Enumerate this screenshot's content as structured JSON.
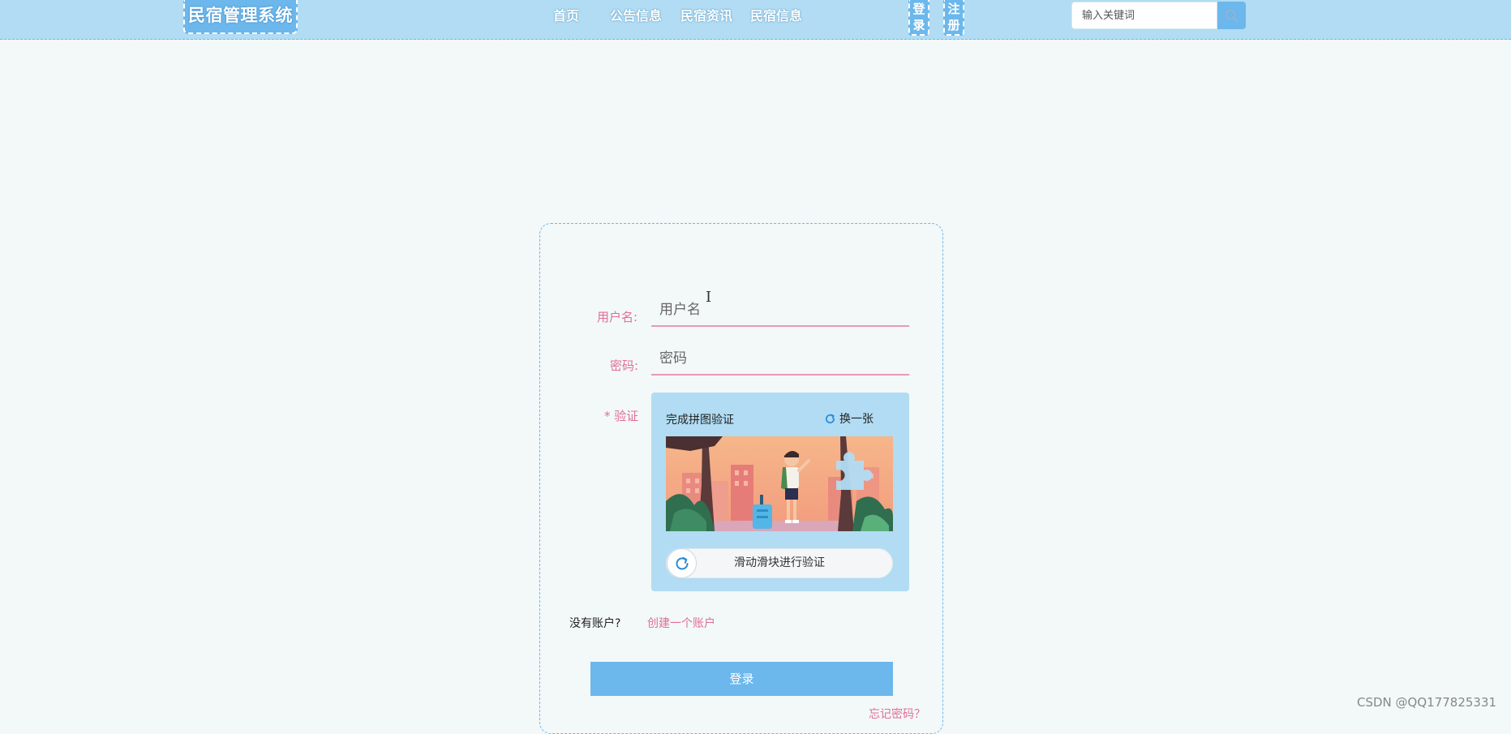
{
  "header": {
    "brand": "民宿管理系统",
    "nav": [
      "首页",
      "公告信息",
      "民宿资讯",
      "民宿信息"
    ],
    "login_button": "登录",
    "register_button": "注册",
    "search_placeholder": "输入关键词"
  },
  "form": {
    "username_label": "用户名:",
    "username_placeholder": "用户名",
    "password_label": "密码:",
    "password_placeholder": "密码",
    "verify_label": "* 验证",
    "captcha_title": "完成拼图验证",
    "captcha_refresh": "换一张",
    "slider_text": "滑动滑块进行验证",
    "no_account": "没有账户?",
    "create_account": "创建一个账户",
    "submit": "登录",
    "forgot_password": "忘记密码？"
  },
  "watermark": "CSDN @QQ177825331",
  "colors": {
    "header_bg": "#b1dcf3",
    "accent_blue": "#6cb7ec",
    "label_pink": "#e06f97",
    "page_bg": "#f3f8f8"
  }
}
